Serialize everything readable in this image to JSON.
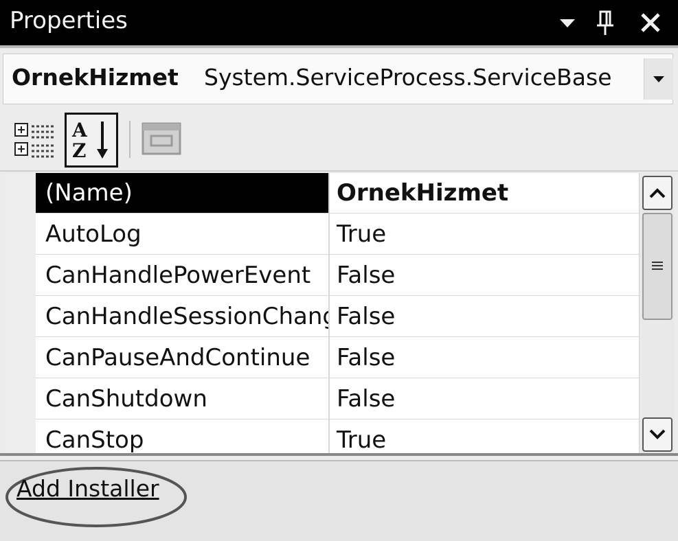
{
  "window": {
    "title": "Properties"
  },
  "object_selector": {
    "name": "OrnekHizmet",
    "type": "System.ServiceProcess.ServiceBase"
  },
  "toolbar": {
    "buttons": [
      {
        "name": "categorized-view",
        "icon": "categorized-icon"
      },
      {
        "name": "alphabetical-view",
        "icon": "sort-az-icon",
        "pressed": true
      },
      {
        "name": "property-pages",
        "icon": "property-pages-icon",
        "enabled": false
      }
    ]
  },
  "properties": [
    {
      "name": "(Name)",
      "value": "OrnekHizmet",
      "selected": true
    },
    {
      "name": "AutoLog",
      "value": "True"
    },
    {
      "name": "CanHandlePowerEvent",
      "value": "False"
    },
    {
      "name": "CanHandleSessionChang",
      "value": "False"
    },
    {
      "name": "CanPauseAndContinue",
      "value": "False"
    },
    {
      "name": "CanShutdown",
      "value": "False"
    },
    {
      "name": "CanStop",
      "value": "True"
    }
  ],
  "commands": {
    "add_installer": "Add Installer"
  }
}
